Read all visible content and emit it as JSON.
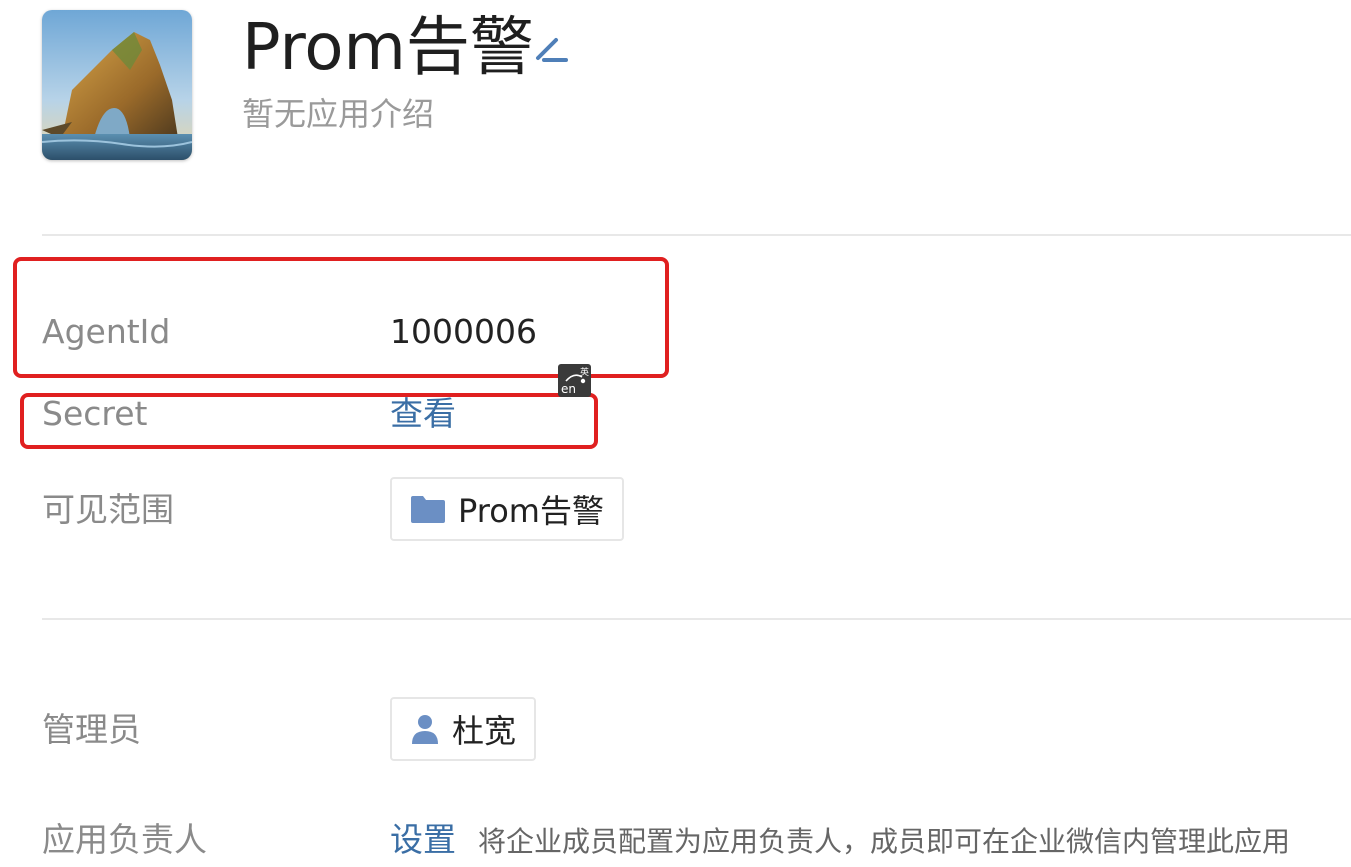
{
  "header": {
    "title": "Prom告警",
    "description": "暂无应用介绍",
    "icon": "app-landscape-icon"
  },
  "rows": {
    "agent_id": {
      "label": "AgentId",
      "value": "1000006"
    },
    "secret": {
      "label": "Secret",
      "link": "查看"
    },
    "visibility": {
      "label": "可见范围",
      "chip": "Prom告警",
      "icon": "folder-icon"
    },
    "admin": {
      "label": "管理员",
      "chip": "杜宽",
      "icon": "user-icon"
    },
    "owner": {
      "label": "应用负责人",
      "link": "设置",
      "hint": "将企业成员配置为应用负责人，成员即可在企业微信内管理此应用"
    }
  },
  "ime": {
    "en": "en",
    "zh": "英"
  },
  "colors": {
    "highlight": "#e02020",
    "link": "#3a6ea5",
    "folder": "#6b8fc4"
  }
}
